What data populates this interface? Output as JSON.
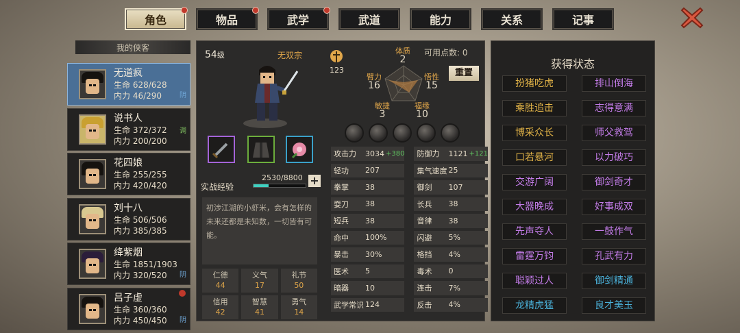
{
  "tabs": [
    {
      "label": "角色",
      "active": true,
      "badge": true
    },
    {
      "label": "物品",
      "active": false,
      "badge": true
    },
    {
      "label": "武学",
      "active": false,
      "badge": true
    },
    {
      "label": "武道",
      "active": false,
      "badge": false
    },
    {
      "label": "能力",
      "active": false,
      "badge": false
    },
    {
      "label": "关系",
      "active": false,
      "badge": false
    },
    {
      "label": "记事",
      "active": false,
      "badge": false
    }
  ],
  "close_icon": "close-x-icon",
  "roster": {
    "header": "我的侠客",
    "heroes": [
      {
        "name": "无道疯",
        "hp": "生命 628/628",
        "mp": "内力 46/290",
        "tag": "阴",
        "selected": true
      },
      {
        "name": "说书人",
        "hp": "生命 372/372",
        "mp": "内力 200/200",
        "tag": "调",
        "selected": false
      },
      {
        "name": "花四娘",
        "hp": "生命 255/255",
        "mp": "内力 420/420",
        "tag": "",
        "selected": false
      },
      {
        "name": "刘十八",
        "hp": "生命 506/506",
        "mp": "内力 385/385",
        "tag": "",
        "selected": false
      },
      {
        "name": "绛紫烟",
        "hp": "生命 1851/1903",
        "mp": "内力 320/520",
        "tag": "阴",
        "selected": false
      },
      {
        "name": "吕子虚",
        "hp": "生命 360/360",
        "mp": "内力 450/450",
        "tag": "阴",
        "selected": false,
        "badge": true
      }
    ]
  },
  "character": {
    "level_num": "54",
    "level_suffix": "级",
    "sect": "无双宗",
    "mark_value": "123",
    "exp_label": "实战经验",
    "exp_value": "2530/8800",
    "exp_fraction": 0.2875,
    "bio": "初涉江湖的小虾米，会有怎样的未来还都是未知数，一切皆有可能。",
    "virtues": [
      {
        "label": "仁德",
        "value": "44"
      },
      {
        "label": "义气",
        "value": "17"
      },
      {
        "label": "礼节",
        "value": "50"
      },
      {
        "label": "信用",
        "value": "42"
      },
      {
        "label": "智慧",
        "value": "41"
      },
      {
        "label": "勇气",
        "value": "14"
      }
    ],
    "radar": {
      "tizhi": {
        "label": "体质",
        "value": "2"
      },
      "bili": {
        "label": "臂力",
        "value": "16"
      },
      "wuxing": {
        "label": "悟性",
        "value": "15"
      },
      "minjie": {
        "label": "敏捷",
        "value": "3"
      },
      "fuyuan": {
        "label": "福缘",
        "value": "10"
      }
    },
    "points_label": "可用点数: 0",
    "reset_label": "重置",
    "stats": [
      {
        "label": "攻击力",
        "value": "3034",
        "bonus": "+380"
      },
      {
        "label": "防御力",
        "value": "1121",
        "bonus": "+121"
      },
      {
        "label": "轻功",
        "value": "207",
        "bonus": ""
      },
      {
        "label": "集气速度",
        "value": "25",
        "bonus": ""
      },
      {
        "label": "拳掌",
        "value": "38",
        "bonus": ""
      },
      {
        "label": "御剑",
        "value": "107",
        "bonus": ""
      },
      {
        "label": "耍刀",
        "value": "38",
        "bonus": ""
      },
      {
        "label": "长兵",
        "value": "38",
        "bonus": ""
      },
      {
        "label": "短兵",
        "value": "38",
        "bonus": ""
      },
      {
        "label": "音律",
        "value": "38",
        "bonus": ""
      },
      {
        "label": "命中",
        "value": "100%",
        "bonus": ""
      },
      {
        "label": "闪避",
        "value": "5%",
        "bonus": ""
      },
      {
        "label": "暴击",
        "value": "30%",
        "bonus": ""
      },
      {
        "label": "格挡",
        "value": "4%",
        "bonus": ""
      },
      {
        "label": "医术",
        "value": "5",
        "bonus": ""
      },
      {
        "label": "毒术",
        "value": "0",
        "bonus": ""
      },
      {
        "label": "暗器",
        "value": "10",
        "bonus": ""
      },
      {
        "label": "连击",
        "value": "7%",
        "bonus": ""
      },
      {
        "label": "武学常识",
        "value": "124",
        "bonus": ""
      },
      {
        "label": "反击",
        "value": "4%",
        "bonus": ""
      }
    ]
  },
  "status": {
    "title": "获得状态",
    "buffs": [
      {
        "label": "扮猪吃虎",
        "color": "gold"
      },
      {
        "label": "排山倒海",
        "color": "purple"
      },
      {
        "label": "乘胜追击",
        "color": "gold"
      },
      {
        "label": "志得意满",
        "color": "purple"
      },
      {
        "label": "博采众长",
        "color": "gold"
      },
      {
        "label": "师父救驾",
        "color": "purple"
      },
      {
        "label": "口若悬河",
        "color": "gold"
      },
      {
        "label": "以力破巧",
        "color": "purple"
      },
      {
        "label": "交游广阔",
        "color": "purple"
      },
      {
        "label": "御剑奇才",
        "color": "purple"
      },
      {
        "label": "大器晚成",
        "color": "purple"
      },
      {
        "label": "好事成双",
        "color": "purple"
      },
      {
        "label": "先声夺人",
        "color": "purple"
      },
      {
        "label": "一鼓作气",
        "color": "purple"
      },
      {
        "label": "雷霆万钧",
        "color": "purple"
      },
      {
        "label": "孔武有力",
        "color": "purple"
      },
      {
        "label": "聪颖过人",
        "color": "purple"
      },
      {
        "label": "御剑精通",
        "color": "blue"
      },
      {
        "label": "龙精虎猛",
        "color": "blue"
      },
      {
        "label": "良才美玉",
        "color": "blue"
      }
    ]
  }
}
